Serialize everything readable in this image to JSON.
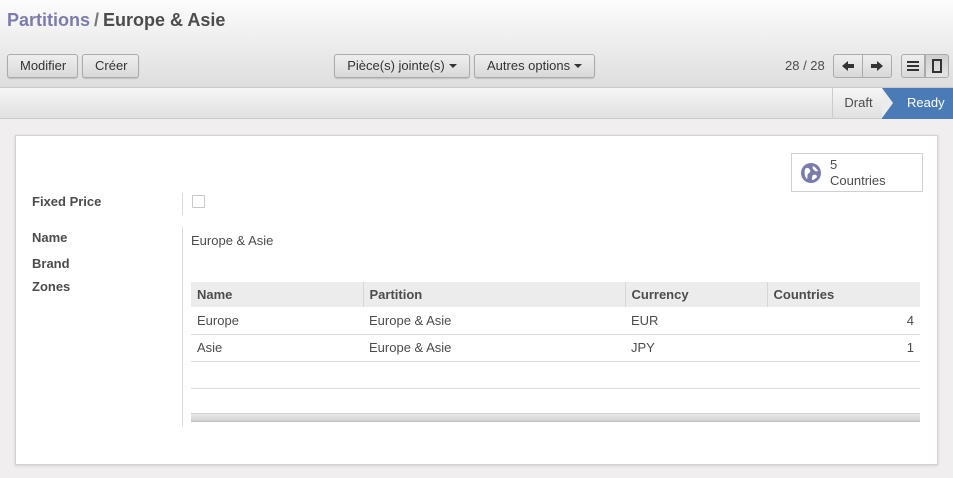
{
  "breadcrumb": {
    "parent": "Partitions",
    "separator": "/",
    "current": "Europe & Asie"
  },
  "toolbar": {
    "edit_label": "Modifier",
    "create_label": "Créer",
    "attachments_label": "Pièce(s) jointe(s)",
    "more_label": "Autres options"
  },
  "pager": {
    "value": "28 / 28"
  },
  "status": {
    "states": [
      "Draft",
      "Ready"
    ],
    "active": "Ready"
  },
  "stat_button": {
    "value": "5",
    "label": "Countries"
  },
  "form": {
    "fixed_price_label": "Fixed Price",
    "fixed_price_checked": false,
    "name_label": "Name",
    "name_value": "Europe & Asie",
    "brand_label": "Brand",
    "zones_label": "Zones"
  },
  "zones_table": {
    "columns": [
      "Name",
      "Partition",
      "Currency",
      "Countries"
    ],
    "rows": [
      {
        "name": "Europe",
        "partition": "Europe & Asie",
        "currency": "EUR",
        "countries": "4"
      },
      {
        "name": "Asie",
        "partition": "Europe & Asie",
        "currency": "JPY",
        "countries": "1"
      }
    ]
  },
  "colors": {
    "breadcrumb_link": "#7c7bad",
    "status_active": "#4a7bb6",
    "stat_icon": "#7c7bad"
  },
  "icons": {
    "pager_prev": "arrow-left-icon",
    "pager_next": "arrow-right-icon",
    "list_view": "list-view-icon",
    "form_view": "form-view-icon",
    "stat": "globe-icon"
  }
}
